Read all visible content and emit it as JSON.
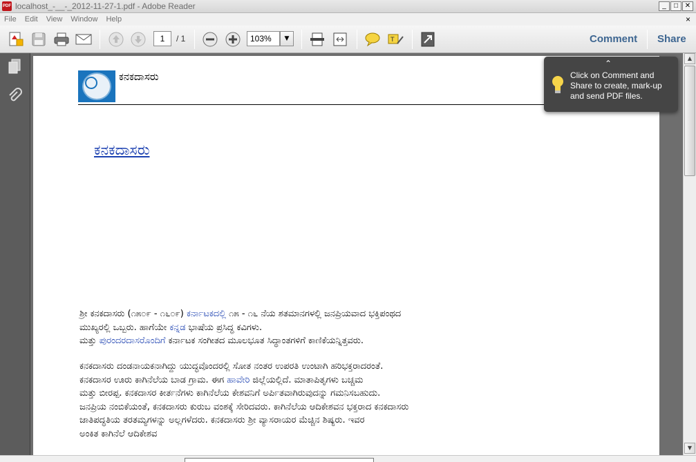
{
  "window": {
    "title": "localhost_-__-_2012-11-27-1.pdf - Adobe Reader",
    "app_icon": "PDF",
    "minimize": "_",
    "maximize": "□",
    "close": "✕"
  },
  "menu": {
    "items": [
      "File",
      "Edit",
      "View",
      "Window",
      "Help"
    ],
    "close": "×"
  },
  "toolbar": {
    "page_current": "1",
    "page_total": "/ 1",
    "zoom": "103%",
    "zoom_dropdown": "▼",
    "comment": "Comment",
    "share": "Share",
    "icons": [
      "create-pdf-icon",
      "save-icon",
      "print-icon",
      "email-icon",
      "previous-page-icon",
      "next-page-icon",
      "zoom-out-icon",
      "zoom-in-icon",
      "fit-page-icon",
      "fit-width-icon",
      "sticky-note-icon",
      "highlight-text-icon",
      "full-screen-icon"
    ]
  },
  "nav_panel": {
    "icons": [
      "pages-icon",
      "attachments-icon"
    ]
  },
  "document": {
    "header_text": "ಕನಕದಾಸರು",
    "heading": "ಕನಕದಾಸರು",
    "para1": {
      "line1_a": "ಶ್ರೀ ಕನಕದಾಸರು (೧೫೦೯ - ೧೬೦೯)",
      "line1_link": "ಕರ್ನಾಟಕದಲ್ಲಿ",
      "line1_b": "೧೫ - ೧೬ ನೆಯ ಶತಮಾನಗಳಲ್ಲಿ ಜನಪ್ರಿಯವಾದ ಭಕ್ತಿಪಂಥದ",
      "line2_a": "ಮುಖ್ಯರಲ್ಲಿ ಒಬ್ಬರು. ಹಾಗೆಯೇ",
      "line2_link": "ಕನ್ನಡ",
      "line2_b": "ಭಾಷೆಯ ಪ್ರಸಿದ್ಧ ಕವಿಗಳು.",
      "line3_a": "ಮತ್ತು",
      "line3_link": "ಪುರಂದರದಾಸರೊಂದಿಗೆ",
      "line3_b": "ಕರ್ನಾಟಕ ಸಂಗೀತದ ಮೂಲಭೂತ ಸಿದ್ಧಾಂತಗಳಿಗೆ ಕಾಣಿಕೆಯನ್ನಿತ್ತವರು."
    },
    "para2": {
      "line1": "ಕನಕದಾಸರು ದಂಡನಾಯಕನಾಗಿದ್ದು ಯುದ್ಧವೊಂದರಲ್ಲಿ ಸೋತ ನಂತರ ಉಪರತಿ ಉಂಟಾಗಿ ಹರಿಭಕ್ತರಾದರಂತೆ.",
      "line2_a": "ಕನಕದಾಸರ ಊರು ಕಾಗಿನೆಲೆಯ ಬಾಡ ಗ್ರಾಮ. ಈಗ",
      "line2_link": "ಹಾವೇರಿ",
      "line2_b": "ಜಿಲ್ಲೆಯಲ್ಲಿದೆ. ಮಾತಾಪಿತೃಗಳು ಬಚ್ಚಮ",
      "line3": "ಮತ್ತು ಬೀರಪ್ಪ. ಕನಕದಾಸರ ಕೀರ್ತನೆಗಳು ಕಾಗಿನೆಲೆಯ ಕೇಶವನಿಗೆ ಅರ್ಪಿತವಾಗಿರುವುದನ್ನು ಗಮನಿಸಬಹುದು.",
      "line4": "ಜನಪ್ರಿಯ ನಂಬಿಕೆಯಂತೆ, ಕನಕದಾಸರು ಕುರುಬ ವಂಶಕ್ಕೆ ಸೇರಿದವರು. ಕಾಗಿನೆಲೆಯ ಆದಿಕೇಶವನ ಭಕ್ತರಾದ ಕನಕದಾಸರು",
      "line5": "ಜಾತಿಪದ್ಧತಿಯ ತರತಮ್ಯಗಳನ್ನು ಅಲ್ಲಗಳೆದರು. ಕನಕದಾಸರು ಶ್ರೀ ವ್ಯಾಸರಾಯರ ಮೆಚ್ಚಿನ ಶಿಷ್ಯರು. ಇವರ",
      "line6": "ಅಂಕಿತ ಕಾಗಿನೆಲೆ ಆದಿಕೇಶವ"
    }
  },
  "tooltip": {
    "caret": "⌃",
    "text": "Click on Comment and Share to create, mark-up and send PDF files."
  },
  "colors": {
    "link": "#1a3fb0",
    "toolbar_link": "#3e6691",
    "nav_panel": "#5c5c5c",
    "doc_bg": "#6e6e6e",
    "tooltip_bg": "#454545"
  }
}
